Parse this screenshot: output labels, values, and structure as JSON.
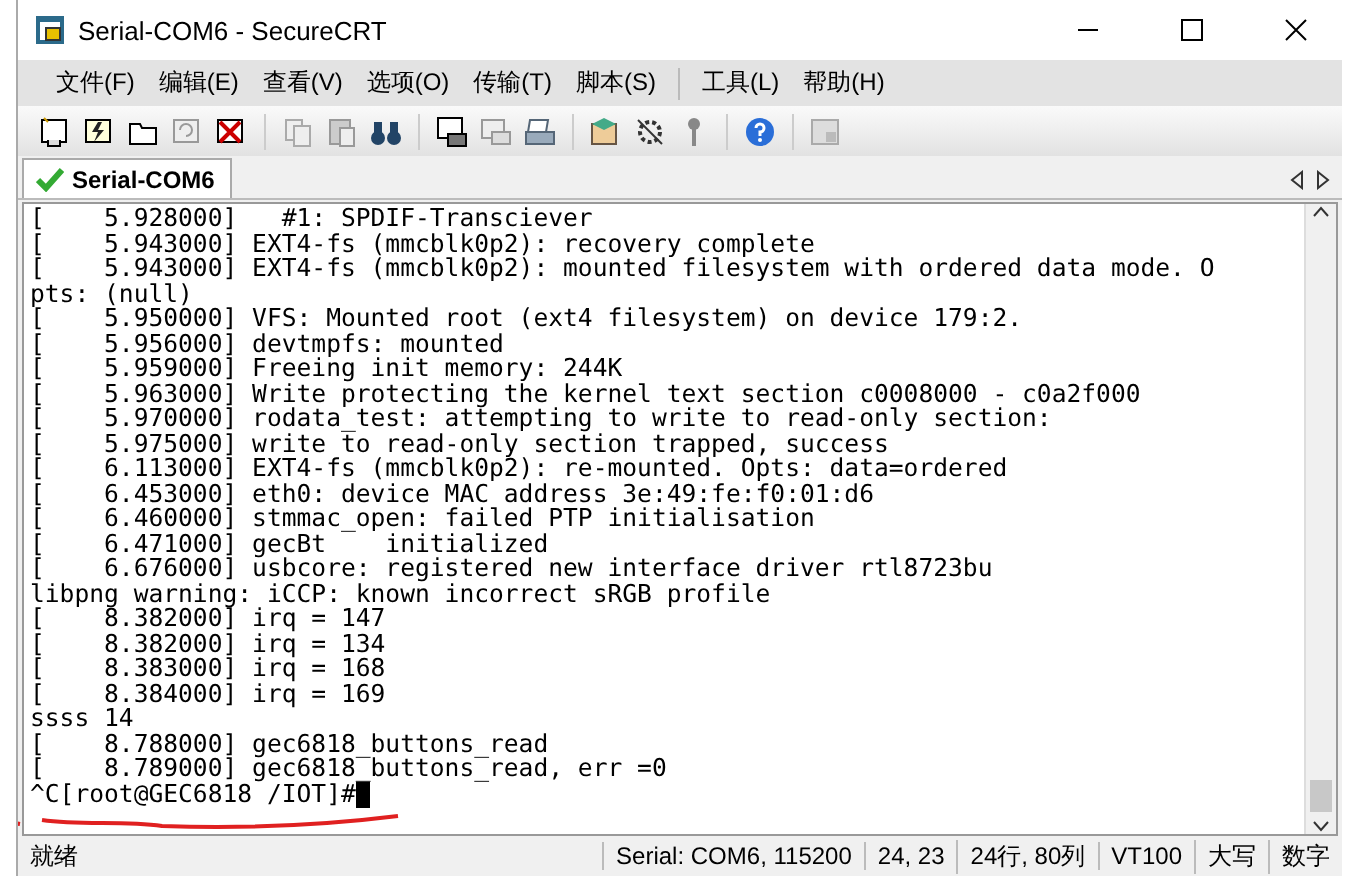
{
  "window": {
    "title": "Serial-COM6 - SecureCRT"
  },
  "menu": [
    "文件(F)",
    "编辑(E)",
    "查看(V)",
    "选项(O)",
    "传输(T)",
    "脚本(S)",
    "工具(L)",
    "帮助(H)"
  ],
  "tabs": [
    {
      "label": "Serial-COM6",
      "selected": true,
      "connected": true
    }
  ],
  "terminal": {
    "lines": [
      "[    5.928000]   #1: SPDIF-Transciever",
      "[    5.943000] EXT4-fs (mmcblk0p2): recovery complete",
      "[    5.943000] EXT4-fs (mmcblk0p2): mounted filesystem with ordered data mode. O",
      "pts: (null)",
      "[    5.950000] VFS: Mounted root (ext4 filesystem) on device 179:2.",
      "[    5.956000] devtmpfs: mounted",
      "[    5.959000] Freeing init memory: 244K",
      "[    5.963000] Write protecting the kernel text section c0008000 - c0a2f000",
      "[    5.970000] rodata_test: attempting to write to read-only section:",
      "[    5.975000] write to read-only section trapped, success",
      "[    6.113000] EXT4-fs (mmcblk0p2): re-mounted. Opts: data=ordered",
      "[    6.453000] eth0: device MAC address 3e:49:fe:f0:01:d6",
      "[    6.460000] stmmac_open: failed PTP initialisation",
      "[    6.471000] gecBt    initialized",
      "[    6.676000] usbcore: registered new interface driver rtl8723bu",
      "libpng warning: iCCP: known incorrect sRGB profile",
      "[    8.382000] irq = 147",
      "[    8.382000] irq = 134",
      "[    8.383000] irq = 168",
      "[    8.384000] irq = 169",
      "ssss 14",
      "[    8.788000] gec6818_buttons_read",
      "[    8.789000] gec6818_buttons_read, err =0",
      "^C[root@GEC6818 /IOT]#"
    ],
    "cursor": true
  },
  "status_bar": [
    "就绪",
    "Serial: COM6, 115200",
    "24,  23",
    "24行, 80列",
    "VT100",
    "大写",
    "数字"
  ]
}
